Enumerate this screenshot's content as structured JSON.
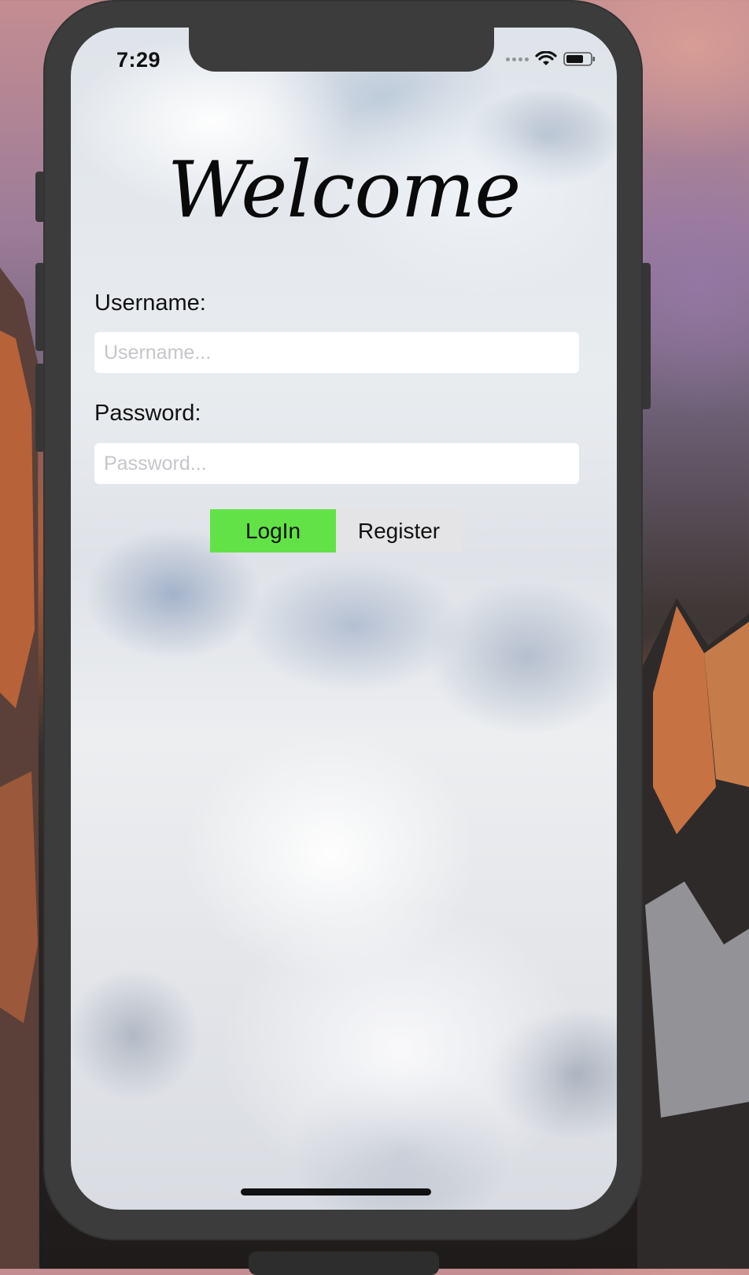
{
  "status_bar": {
    "time": "7:29"
  },
  "welcome_title": "Welcome",
  "form": {
    "username_label": "Username:",
    "username_placeholder": "Username...",
    "username_value": "",
    "password_label": "Password:",
    "password_placeholder": "Password...",
    "password_value": ""
  },
  "buttons": {
    "login_label": "LogIn",
    "register_label": "Register"
  },
  "colors": {
    "login_button": "#63e247",
    "register_button": "#e4e4e6",
    "device_frame": "#3c3c3c"
  },
  "icons": {
    "status": [
      "cellular-signal-icon",
      "wifi-icon",
      "battery-icon"
    ]
  }
}
